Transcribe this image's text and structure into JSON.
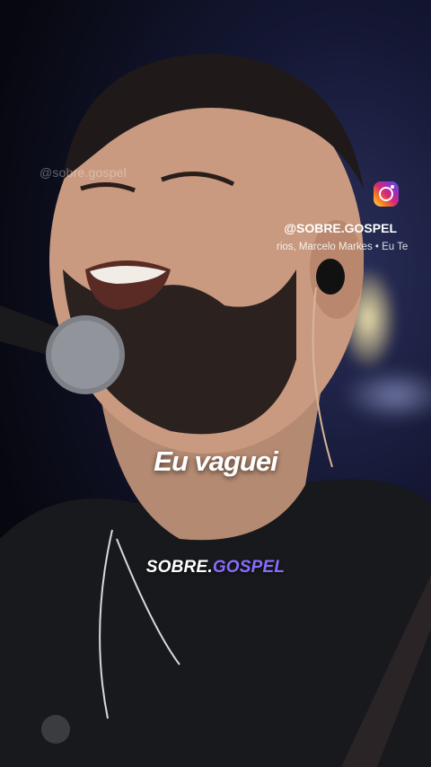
{
  "watermark": {
    "text": "@sobre.gospel"
  },
  "instagram": {
    "icon": "instagram-icon",
    "handle": "@SOBRE.GOSPEL"
  },
  "credits": {
    "text": "rios, Marcelo Markes • Eu Te"
  },
  "lyric": {
    "text": "Eu vaguei"
  },
  "brand": {
    "part1": "SOBRE.",
    "part2": "GOSPEL"
  },
  "colors": {
    "brand_accent": "#8a6cff",
    "background": "#0b0d1a"
  }
}
